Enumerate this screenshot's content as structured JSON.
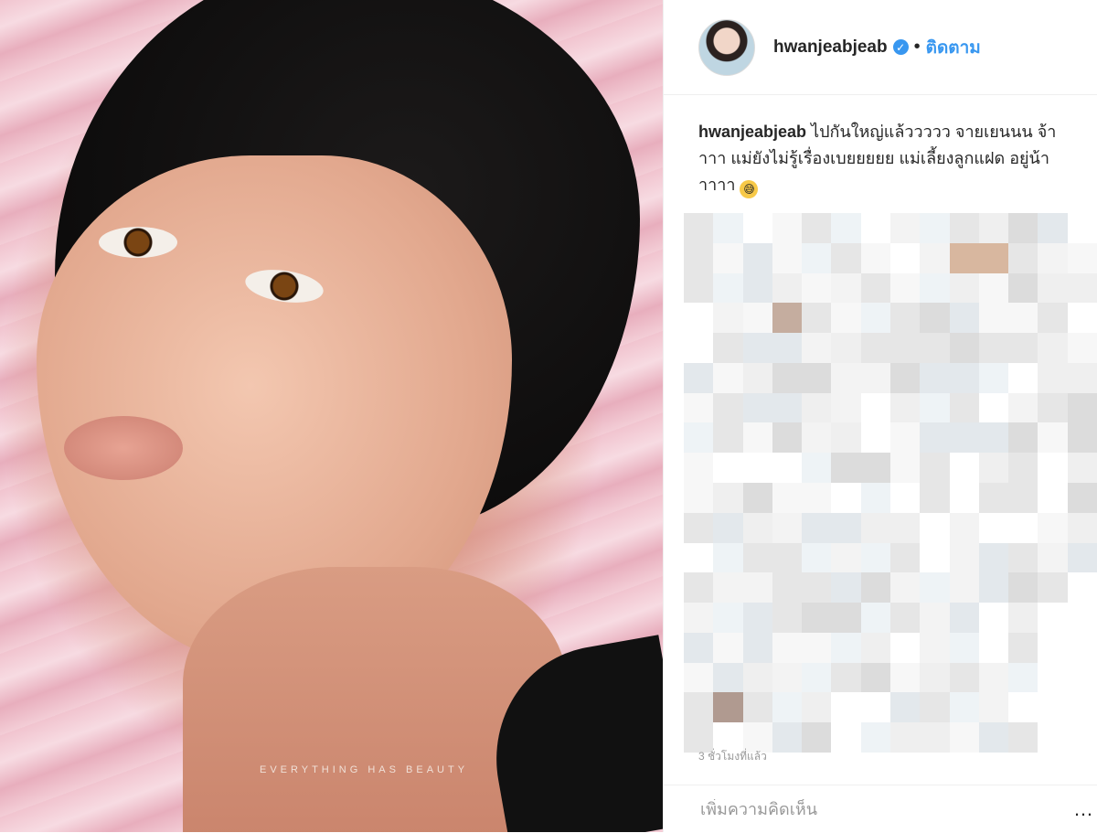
{
  "photo": {
    "tagline": "EVERYTHING HAS BEAUTY"
  },
  "profile": {
    "username": "hwanjeabjeab",
    "verified": true,
    "follow_label": "ติดตาม",
    "separator": "•"
  },
  "caption": {
    "username": "hwanjeabjeab",
    "text": "ไปกันใหญ่แล้ววววว จายเยนนน จ้าาาา แม่ยังไม่รู้เรื่องเบยยยยย แม่เลี้ยงลูกแฝด อยู่น้าาาาา",
    "emoji": "😅"
  },
  "comments_obscured": true,
  "timestamp": "3 ชั่วโมงที่แล้ว",
  "comment_box": {
    "placeholder": "เพิ่มความคิดเห็น",
    "more_label": "…"
  },
  "colors": {
    "link": "#3897f0",
    "text": "#262626",
    "muted": "#999999",
    "border": "#efefef"
  },
  "icons": [
    "verified-badge-icon",
    "more-options-icon"
  ]
}
